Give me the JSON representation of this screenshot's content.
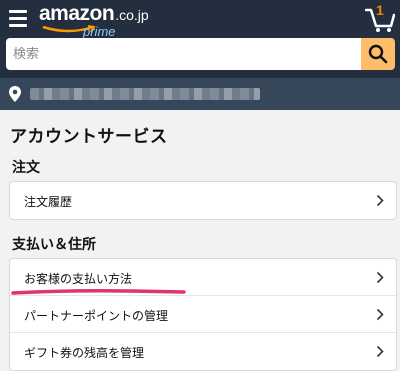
{
  "header": {
    "logo_word": "amazon",
    "logo_tld": ".co.jp",
    "logo_sub": "prime",
    "cart_count": "1"
  },
  "search": {
    "placeholder": "検索"
  },
  "page": {
    "title": "アカウントサービス"
  },
  "sections": [
    {
      "heading": "注文",
      "items": [
        {
          "label": "注文履歴"
        }
      ]
    },
    {
      "heading": "支払い＆住所",
      "items": [
        {
          "label": "お客様の支払い方法"
        },
        {
          "label": "パートナーポイントの管理"
        },
        {
          "label": "ギフト券の残高を管理"
        }
      ]
    }
  ],
  "colors": {
    "header_bg": "#232f3e",
    "address_bg": "#37475a",
    "search_button": "#febd69",
    "annotation": "#e0336f"
  },
  "icons": [
    "menu-icon",
    "cart-icon",
    "search-icon",
    "location-pin-icon",
    "chevron-right-icon"
  ]
}
